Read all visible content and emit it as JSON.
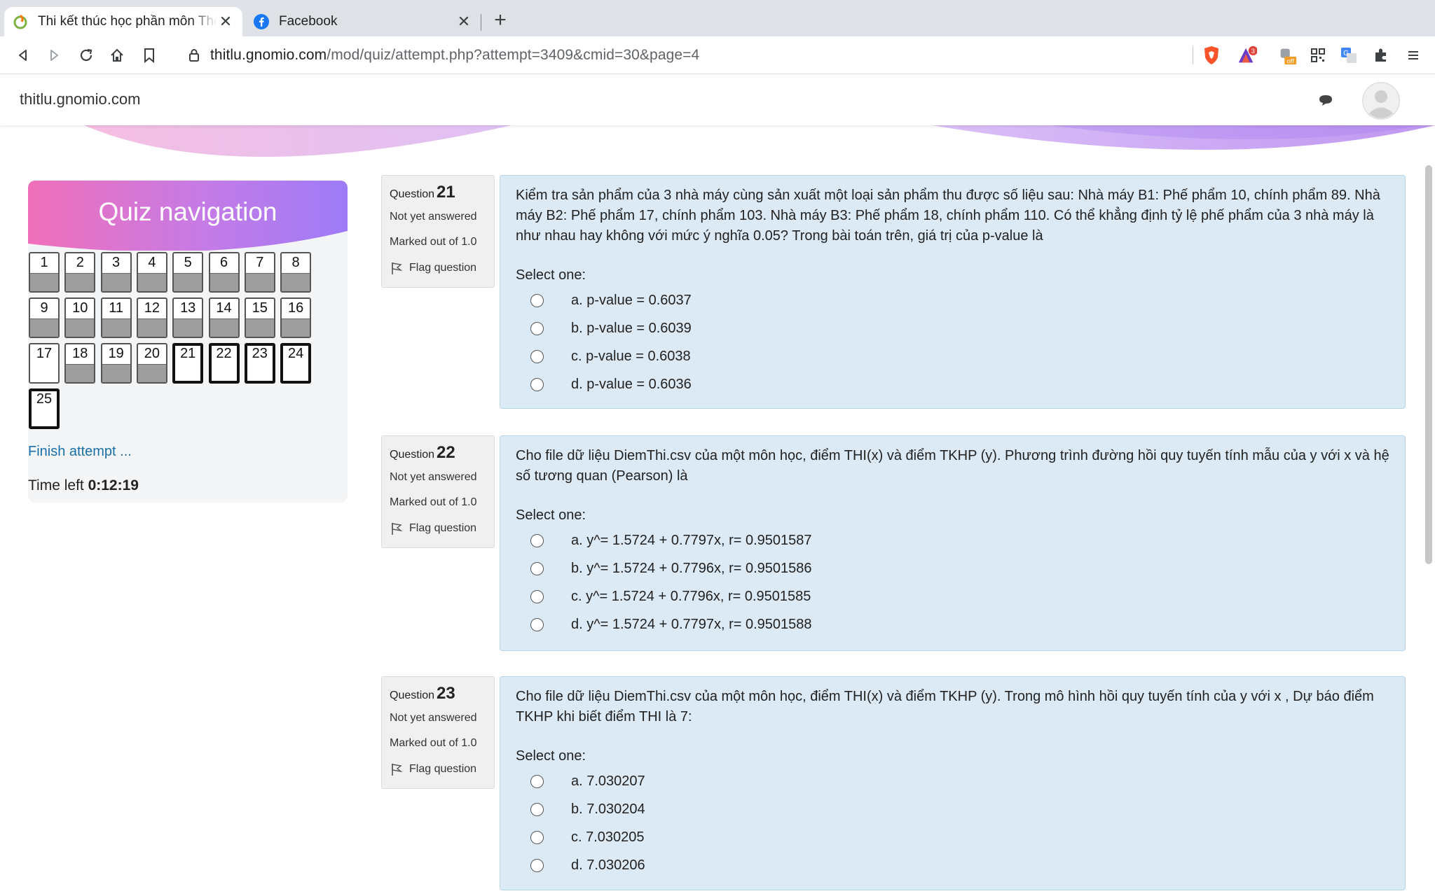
{
  "browser": {
    "tabs": [
      {
        "title": "Thi kết thúc học phần môn Thống kê",
        "favicon": "moodle-icon",
        "active": true
      },
      {
        "title": "Facebook",
        "favicon": "facebook-icon",
        "active": false
      }
    ],
    "url_host": "thitlu.gnomio.com",
    "url_path": "/mod/quiz/attempt.php?attempt=3409&cmid=30&page=4",
    "brave_badge": "3",
    "ext_badge": "off"
  },
  "site": {
    "brand": "thitlu.gnomio.com"
  },
  "nav": {
    "title": "Quiz navigation",
    "buttons": [
      {
        "n": "1",
        "answered": true
      },
      {
        "n": "2",
        "answered": true
      },
      {
        "n": "3",
        "answered": true
      },
      {
        "n": "4",
        "answered": true
      },
      {
        "n": "5",
        "answered": true
      },
      {
        "n": "6",
        "answered": true
      },
      {
        "n": "7",
        "answered": true
      },
      {
        "n": "8",
        "answered": true
      },
      {
        "n": "9",
        "answered": true
      },
      {
        "n": "10",
        "answered": true
      },
      {
        "n": "11",
        "answered": true
      },
      {
        "n": "12",
        "answered": true
      },
      {
        "n": "13",
        "answered": true
      },
      {
        "n": "14",
        "answered": true
      },
      {
        "n": "15",
        "answered": true
      },
      {
        "n": "16",
        "answered": true
      },
      {
        "n": "17",
        "answered": false
      },
      {
        "n": "18",
        "answered": true
      },
      {
        "n": "19",
        "answered": true
      },
      {
        "n": "20",
        "answered": true
      },
      {
        "n": "21",
        "answered": false,
        "current": true
      },
      {
        "n": "22",
        "answered": false,
        "current": true
      },
      {
        "n": "23",
        "answered": false,
        "current": true
      },
      {
        "n": "24",
        "answered": false,
        "current": true
      },
      {
        "n": "25",
        "answered": false,
        "current": true
      }
    ],
    "finish": "Finish attempt ...",
    "time_label": "Time left",
    "time_value": "0:12:19"
  },
  "questions": [
    {
      "label": "Question",
      "number": "21",
      "state": "Not yet answered",
      "grade": "Marked out of 1.0",
      "flag": "Flag question",
      "text": "Kiểm tra sản phẩm của 3 nhà máy cùng sản xuất một loại sản phẩm thu được số liệu sau: Nhà máy B1: Phế phẩm 10, chính phẩm 89. Nhà máy B2: Phế phẩm 17, chính phẩm 103. Nhà máy B3: Phế phẩm 18, chính phẩm 110. Có thể khẳng định tỷ lệ phế phẩm của 3 nhà máy là như nhau hay không với mức ý nghĩa 0.05? Trong bài toán trên, giá trị của p-value là",
      "select": "Select one:",
      "answers": [
        "a. p-value = 0.6037",
        "b. p-value = 0.6039",
        "c. p-value = 0.6038",
        "d. p-value = 0.6036"
      ]
    },
    {
      "label": "Question",
      "number": "22",
      "state": "Not yet answered",
      "grade": "Marked out of 1.0",
      "flag": "Flag question",
      "text": "Cho file dữ liệu DiemThi.csv của một môn học, điểm THI(x) và điểm TKHP (y). Phương trình đường hồi quy tuyến tính mẫu của y với x và hệ số tương quan (Pearson) là",
      "select": "Select one:",
      "answers": [
        "a. y^= 1.5724 + 0.7797x, r= 0.9501587",
        "b. y^= 1.5724 + 0.7796x, r= 0.9501586",
        "c. y^= 1.5724 + 0.7796x, r= 0.9501585",
        "d. y^= 1.5724 + 0.7797x, r= 0.9501588"
      ]
    },
    {
      "label": "Question",
      "number": "23",
      "state": "Not yet answered",
      "grade": "Marked out of 1.0",
      "flag": "Flag question",
      "text": "Cho file dữ liệu DiemThi.csv của một môn học, điểm THI(x) và điểm TKHP (y). Trong mô hình hồi quy tuyến tính của y với x , Dự báo điểm TKHP khi biết điểm THI là 7:",
      "select": "Select one:",
      "answers": [
        "a. 7.030207",
        "b. 7.030204",
        "c. 7.030205",
        "d. 7.030206"
      ]
    }
  ],
  "colors": {
    "question_bg": "#dbeaf5",
    "nav_gradient_start": "#f06fb9",
    "nav_gradient_end": "#9d7bf7",
    "link": "#1a6fa8"
  }
}
